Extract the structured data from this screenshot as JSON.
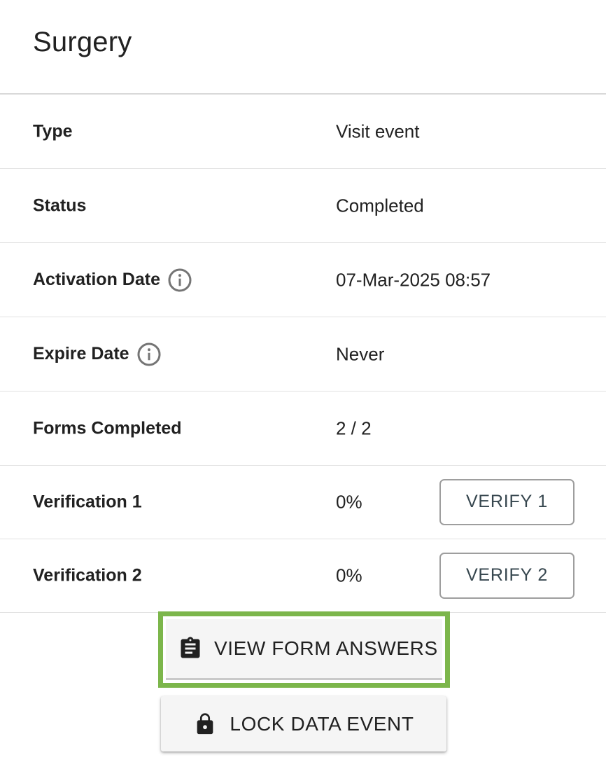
{
  "header": {
    "title": "Surgery"
  },
  "details": {
    "type": {
      "label": "Type",
      "value": "Visit event"
    },
    "status": {
      "label": "Status",
      "value": "Completed"
    },
    "activation_date": {
      "label": "Activation Date",
      "value": "07-Mar-2025 08:57",
      "icon": "info-icon"
    },
    "expire_date": {
      "label": "Expire Date",
      "value": "Never",
      "icon": "info-icon"
    },
    "forms_completed": {
      "label": "Forms Completed",
      "value": "2 / 2"
    },
    "verification_1": {
      "label": "Verification 1",
      "value": "0%",
      "button_label": "VERIFY 1"
    },
    "verification_2": {
      "label": "Verification 2",
      "value": "0%",
      "button_label": "VERIFY 2"
    }
  },
  "actions": {
    "view_form_answers": {
      "label": "VIEW FORM ANSWERS",
      "icon": "clipboard-icon"
    },
    "lock_data_event": {
      "label": "LOCK DATA EVENT",
      "icon": "lock-icon"
    }
  },
  "colors": {
    "highlight": "#7cb64b",
    "text": "#212121",
    "button_text": "#37474f",
    "divider": "#e2e2e2"
  }
}
